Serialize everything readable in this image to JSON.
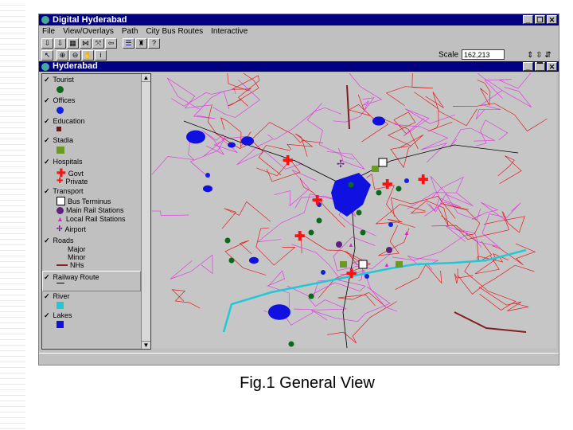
{
  "app": {
    "title": "Digital Hyderabad",
    "menu": [
      "File",
      "View/Overlays",
      "Path",
      "City Bus Routes",
      "Interactive"
    ]
  },
  "scale": {
    "label": "Scale",
    "value": "162,213"
  },
  "map_window": {
    "title": "Hyderabad"
  },
  "legend": {
    "tourist": "Tourist",
    "offices": "Offices",
    "education": "Education",
    "stadia": "Stadia",
    "hospitals": "Hospitals",
    "govt": "Govt",
    "private": "Private",
    "transport": "Transport",
    "bus": "Bus Terminus",
    "main_rail": "Main Rail Stations",
    "local_rail": "Local Rail Stations",
    "airport": "Airport",
    "roads": "Roads",
    "major": "Major",
    "minor": "Minor",
    "nh": "NHs",
    "railway": "Railway Route",
    "river": "River",
    "lakes": "Lakes"
  },
  "colors": {
    "tourist": "#0a6a1a",
    "offices": "#1020e0",
    "education": "#701818",
    "stadia": "#6a9a20",
    "hospital": "#ff1010",
    "rail": "#602080",
    "local": "#e020e0",
    "river": "#20c8d8",
    "lake": "#1010e0",
    "road_major": "#e02020",
    "road_minor": "#e040e0",
    "nh": "#802020"
  },
  "caption": "Fig.1 General View"
}
